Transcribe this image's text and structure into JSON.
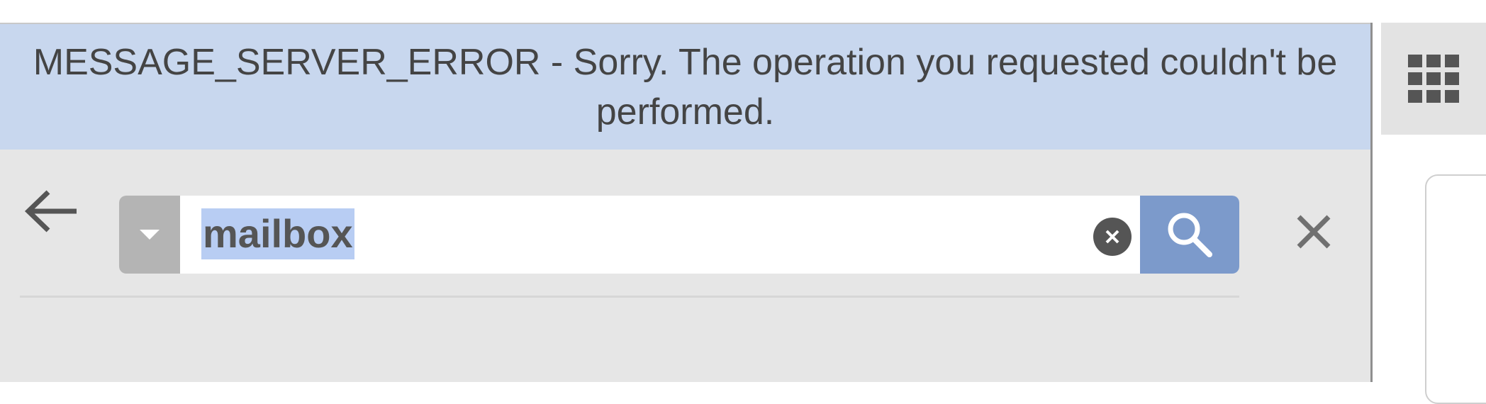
{
  "error_banner": {
    "message": "MESSAGE_SERVER_ERROR - Sorry. The operation you requested couldn't be performed."
  },
  "search": {
    "query": "mailbox",
    "back_icon": "arrow-left-icon",
    "dropdown_icon": "caret-down-icon",
    "clear_icon": "clear-circle-icon",
    "search_icon": "magnifier-icon",
    "close_icon": "close-icon"
  },
  "toolbar": {
    "apps_icon": "grid-icon"
  },
  "colors": {
    "banner_background": "#c8d7ee",
    "panel_background": "#e6e6e6",
    "search_button": "#7c9acb",
    "text_highlight": "#b8cdf3"
  }
}
